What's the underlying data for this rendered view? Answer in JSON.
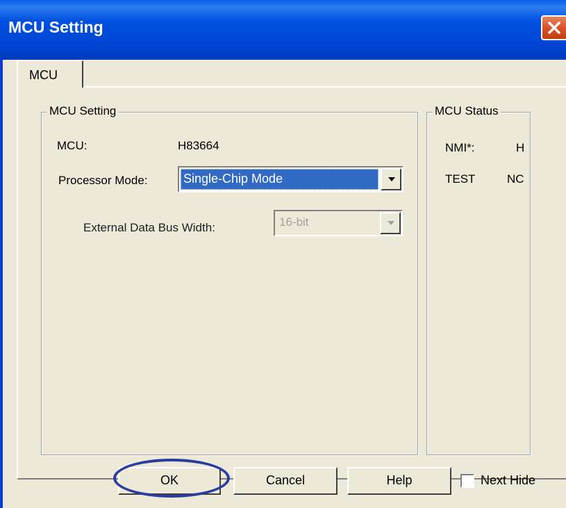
{
  "window": {
    "title": "MCU Setting"
  },
  "tabs": [
    {
      "label": "MCU",
      "active": true
    }
  ],
  "mcu_setting": {
    "group_label": "MCU Setting",
    "mcu_label": "MCU:",
    "mcu_value": "H83664",
    "processor_mode_label": "Processor Mode:",
    "processor_mode_value": "Single-Chip Mode",
    "bus_width_label": "External Data Bus Width:",
    "bus_width_value": "16-bit"
  },
  "mcu_status": {
    "group_label": "MCU Status",
    "rows": [
      {
        "name": "NMI*:",
        "value": "H"
      },
      {
        "name": "TEST",
        "value": "NC"
      }
    ]
  },
  "buttons": {
    "ok": "OK",
    "cancel": "Cancel",
    "help": "Help"
  },
  "next_hide": {
    "label": "Next Hide",
    "checked": false
  },
  "colors": {
    "titlebar": "#0050e0",
    "selection": "#316ac5",
    "highlight_ring": "#2a3c9e"
  }
}
